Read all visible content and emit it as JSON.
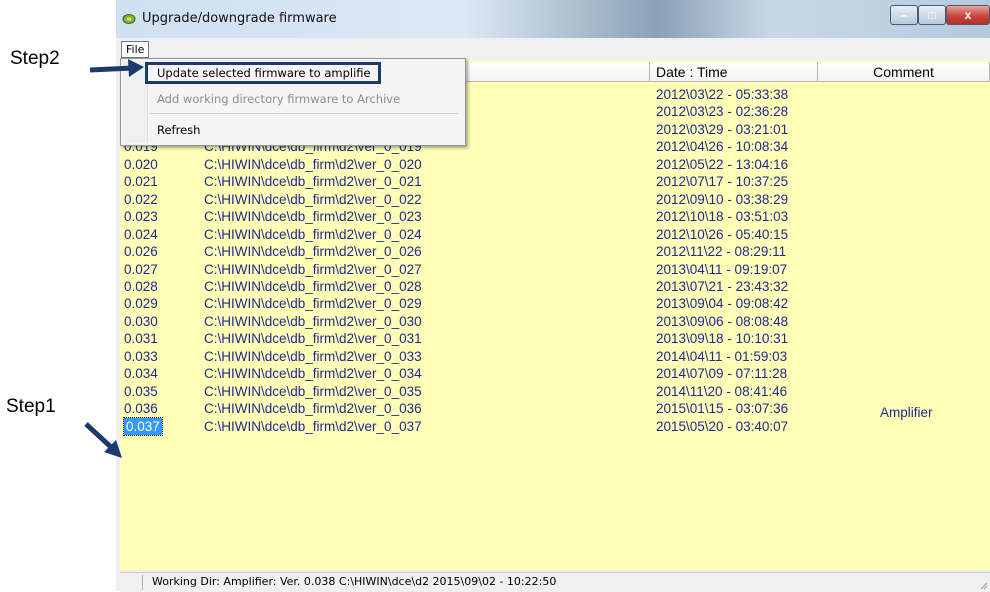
{
  "window": {
    "title": "Upgrade/downgrade firmware",
    "buttons": {
      "minimize": "–",
      "maximize": "□",
      "close": "x"
    }
  },
  "menu": {
    "file": "File"
  },
  "dropdown": {
    "items": [
      {
        "label": "Update selected firmware to amplifie",
        "enabled": true
      },
      {
        "label": "Add working directory firmware to Archive",
        "enabled": false
      },
      {
        "label": "Refresh",
        "enabled": true
      }
    ]
  },
  "table": {
    "headers": {
      "date_time": "Date : Time",
      "comment": "Comment"
    },
    "rows": [
      {
        "version": "",
        "path": "",
        "date": "2012\\03\\22 - 05:33:38",
        "comment": ""
      },
      {
        "version": "",
        "path": "",
        "date": "2012\\03\\23 - 02:36:28",
        "comment": ""
      },
      {
        "version": "",
        "path": "",
        "date": "2012\\03\\29 - 03:21:01",
        "comment": ""
      },
      {
        "version": "0.019",
        "path": "C:\\HIWIN\\dce\\db_firm\\d2\\ver_0_019",
        "date": "2012\\04\\26 - 10:08:34",
        "comment": ""
      },
      {
        "version": "0.020",
        "path": "C:\\HIWIN\\dce\\db_firm\\d2\\ver_0_020",
        "date": "2012\\05\\22 - 13:04:16",
        "comment": ""
      },
      {
        "version": "0.021",
        "path": "C:\\HIWIN\\dce\\db_firm\\d2\\ver_0_021",
        "date": "2012\\07\\17 - 10:37:25",
        "comment": ""
      },
      {
        "version": "0.022",
        "path": "C:\\HIWIN\\dce\\db_firm\\d2\\ver_0_022",
        "date": "2012\\09\\10 - 03:38:29",
        "comment": ""
      },
      {
        "version": "0.023",
        "path": "C:\\HIWIN\\dce\\db_firm\\d2\\ver_0_023",
        "date": "2012\\10\\18 - 03:51:03",
        "comment": ""
      },
      {
        "version": "0.024",
        "path": "C:\\HIWIN\\dce\\db_firm\\d2\\ver_0_024",
        "date": "2012\\10\\26 - 05:40:15",
        "comment": ""
      },
      {
        "version": "0.026",
        "path": "C:\\HIWIN\\dce\\db_firm\\d2\\ver_0_026",
        "date": "2012\\11\\22 - 08:29:11",
        "comment": ""
      },
      {
        "version": "0.027",
        "path": "C:\\HIWIN\\dce\\db_firm\\d2\\ver_0_027",
        "date": "2013\\04\\11 - 09:19:07",
        "comment": ""
      },
      {
        "version": "0.028",
        "path": "C:\\HIWIN\\dce\\db_firm\\d2\\ver_0_028",
        "date": "2013\\07\\21 - 23:43:32",
        "comment": ""
      },
      {
        "version": "0.029",
        "path": "C:\\HIWIN\\dce\\db_firm\\d2\\ver_0_029",
        "date": "2013\\09\\04 - 09:08:42",
        "comment": ""
      },
      {
        "version": "0.030",
        "path": "C:\\HIWIN\\dce\\db_firm\\d2\\ver_0_030",
        "date": "2013\\09\\06 - 08:08:48",
        "comment": ""
      },
      {
        "version": "0.031",
        "path": "C:\\HIWIN\\dce\\db_firm\\d2\\ver_0_031",
        "date": "2013\\09\\18 - 10:10:31",
        "comment": ""
      },
      {
        "version": "0.033",
        "path": "C:\\HIWIN\\dce\\db_firm\\d2\\ver_0_033",
        "date": "2014\\04\\11 - 01:59:03",
        "comment": ""
      },
      {
        "version": "0.034",
        "path": "C:\\HIWIN\\dce\\db_firm\\d2\\ver_0_034",
        "date": "2014\\07\\09 - 07:11:28",
        "comment": ""
      },
      {
        "version": "0.035",
        "path": "C:\\HIWIN\\dce\\db_firm\\d2\\ver_0_035",
        "date": "2014\\11\\20 - 08:41:46",
        "comment": ""
      },
      {
        "version": "0.036",
        "path": "C:\\HIWIN\\dce\\db_firm\\d2\\ver_0_036",
        "date": "2015\\01\\15 - 03:07:36",
        "comment": "Amplifier"
      },
      {
        "version": "0.037",
        "path": "C:\\HIWIN\\dce\\db_firm\\d2\\ver_0_037",
        "date": "2015\\05\\20 - 03:40:07",
        "comment": "",
        "selected": true
      }
    ]
  },
  "status": {
    "text": "Working Dir:  Amplifier: Ver. 0.038 C:\\HIWIN\\dce\\d2   2015\\09\\02 - 10:22:50"
  },
  "annotations": {
    "step1": "Step1",
    "step2": "Step2"
  },
  "colors": {
    "list_bg": "#ffffb8",
    "row_text": "#1f2a8f",
    "selection": "#3399ff",
    "annotation_arrow": "#1c3a6b"
  }
}
